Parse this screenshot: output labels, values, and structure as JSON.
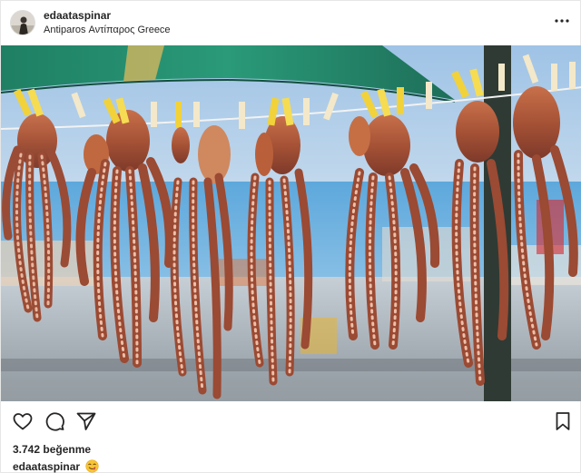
{
  "post": {
    "username": "edaataspinar",
    "location": "Antiparos Αντίπαρος Greece",
    "likes_text": "3.742 beğenme",
    "caption": {
      "username": "edaataspinar",
      "emoji": "savoring-food-emoji"
    }
  },
  "icons": {
    "more": "more-options-icon",
    "like": "heart-icon",
    "comment": "comment-icon",
    "share": "paper-plane-icon",
    "save": "bookmark-icon"
  },
  "photo": {
    "subject": "octopuses drying on a clothesline with clothespins"
  },
  "colors": {
    "text": "#262626",
    "border": "#dbdbdb",
    "background": "#ffffff"
  }
}
